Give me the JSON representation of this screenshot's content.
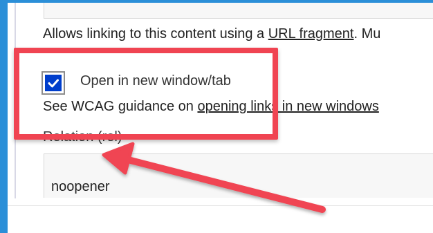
{
  "description": {
    "text_before": "Allows linking to this content using a ",
    "link_text": "URL fragment",
    "text_after": ". Mu"
  },
  "new_window": {
    "label": "Open in new window/tab",
    "checked": true,
    "accent_color": "#003ecc"
  },
  "wcag": {
    "text_before": "See WCAG guidance on ",
    "link_text": "opening links in new windows"
  },
  "rel": {
    "label": "Relation (rel)",
    "value": "noopener"
  },
  "annotation": {
    "color": "#f04452",
    "frame_color": "#2b8fd8"
  }
}
